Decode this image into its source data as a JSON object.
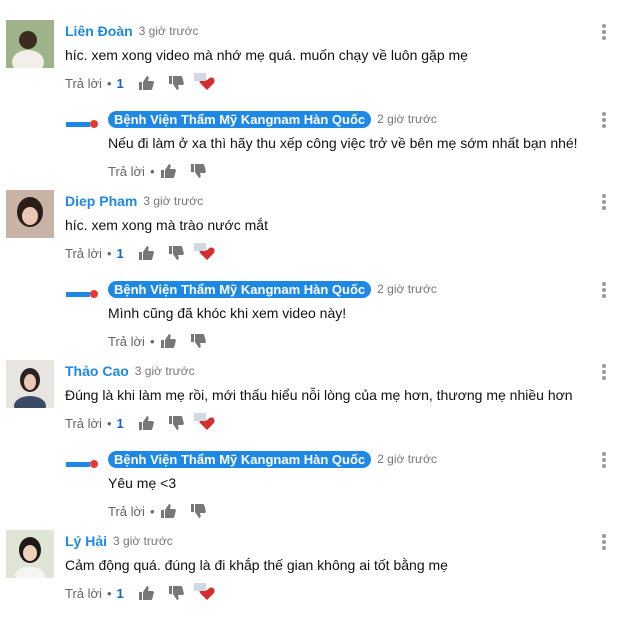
{
  "labels": {
    "reply": "Trả lời",
    "dot": "•"
  },
  "colors": {
    "link": "#1e88e5",
    "heart": "#d32f2f"
  },
  "threads": [
    {
      "author": "Liên Đoàn",
      "time": "3 giờ trước",
      "text": "híc. xem xong video mà nhớ mẹ quá. muốn chạy về luôn gặp mẹ",
      "likes": "1",
      "reply": {
        "author": "Bệnh Viện Thẩm Mỹ Kangnam Hàn Quốc",
        "time": "2 giờ trước",
        "text": "Nếu đi làm ở xa thì hãy thu xếp công việc trở về bên mẹ sớm nhất bạn nhé!"
      }
    },
    {
      "author": "Diep Pham",
      "time": "3 giờ trước",
      "text": "híc. xem xong mà trào nước mắt",
      "likes": "1",
      "reply": {
        "author": "Bệnh Viện Thẩm Mỹ Kangnam Hàn Quốc",
        "time": "2 giờ trước",
        "text": "Mình cũng đã khóc khi xem video này!"
      }
    },
    {
      "author": "Thảo Cao",
      "time": "3 giờ trước",
      "text": "Đúng là khi làm mẹ rồi, mới thấu hiểu nỗi lòng của mẹ hơn, thương mẹ nhiều hơn",
      "likes": "1",
      "reply": {
        "author": "Bệnh Viện Thẩm Mỹ Kangnam Hàn Quốc",
        "time": "2 giờ trước",
        "text": "Yêu mẹ <3"
      }
    },
    {
      "author": "Lý Hải",
      "time": "3 giờ trước",
      "text": "Cảm động quá. đúng là đi khắp thế gian không ai tốt bằng mẹ",
      "likes": "1"
    }
  ]
}
